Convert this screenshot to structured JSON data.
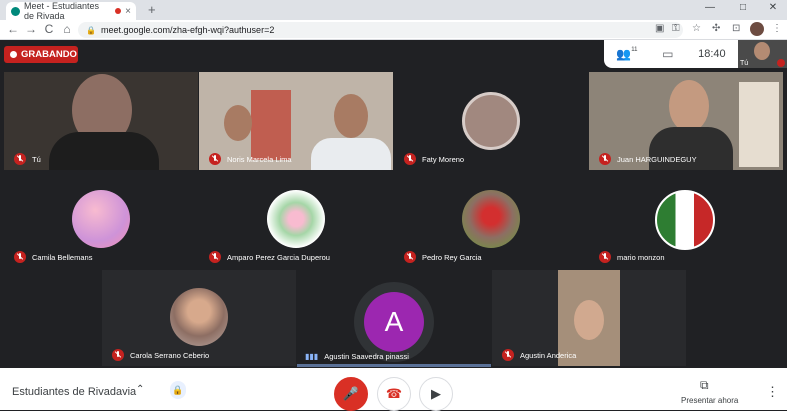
{
  "browser": {
    "tab_title": "Meet - Estudiantes de Rivada",
    "tab_close": "×",
    "new_tab": "+",
    "window_controls": [
      "—",
      "□",
      "✕"
    ],
    "nav": [
      "←",
      "→",
      "C",
      "⌂"
    ],
    "url": "meet.google.com/zha-efgh-wqi?authuser=2"
  },
  "meet": {
    "recording_label": "GRABANDO",
    "participants_count": "11",
    "time": "18:40",
    "self_label": "Tú",
    "tiles": [
      {
        "name": "Tú"
      },
      {
        "name": "Noris Marcela Lima"
      },
      {
        "name": "Faty Moreno"
      },
      {
        "name": "Juan HARGUINDEGUY"
      },
      {
        "name": "Camila Bellemans"
      },
      {
        "name": "Amparo Perez Garcia Duperou"
      },
      {
        "name": "Pedro Rey Garcia"
      },
      {
        "name": "mario monzon"
      },
      {
        "name": "Carola Serrano Ceberio"
      },
      {
        "name": "Agustin Saavedra pinassi",
        "initial": "A"
      },
      {
        "name": "Agustin Anderica"
      }
    ],
    "meeting_name": "Estudiantes de Rivadavia",
    "present_label": "Presentar ahora",
    "colors": {
      "recording": "#c5221f",
      "avatar_purple": "#9c27b0",
      "mic_off": "#d93025"
    }
  }
}
